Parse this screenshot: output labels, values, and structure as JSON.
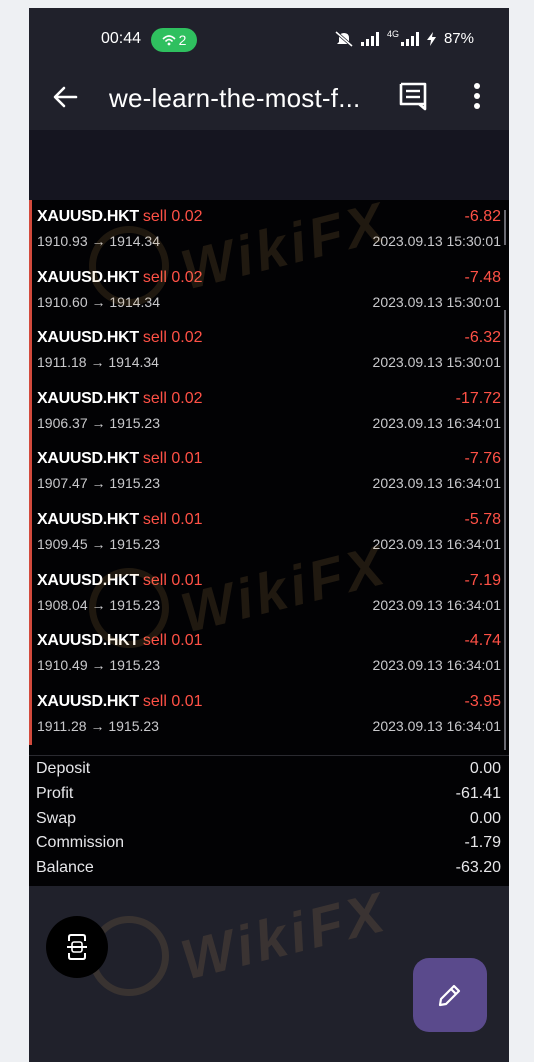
{
  "status": {
    "time": "00:44",
    "hotspot_count": "2",
    "battery": "87%",
    "network": "4G"
  },
  "appbar": {
    "title": "we-learn-the-most-f..."
  },
  "trades": [
    {
      "symbol": "XAUUSD.HKT",
      "side": "sell 0.02",
      "profit": "-6.82",
      "prices": "1910.93 → 1914.34",
      "time": "2023.09.13 15:30:01"
    },
    {
      "symbol": "XAUUSD.HKT",
      "side": "sell 0.02",
      "profit": "-7.48",
      "prices": "1910.60 → 1914.34",
      "time": "2023.09.13 15:30:01"
    },
    {
      "symbol": "XAUUSD.HKT",
      "side": "sell 0.02",
      "profit": "-6.32",
      "prices": "1911.18 → 1914.34",
      "time": "2023.09.13 15:30:01"
    },
    {
      "symbol": "XAUUSD.HKT",
      "side": "sell 0.02",
      "profit": "-17.72",
      "prices": "1906.37 → 1915.23",
      "time": "2023.09.13 16:34:01"
    },
    {
      "symbol": "XAUUSD.HKT",
      "side": "sell 0.01",
      "profit": "-7.76",
      "prices": "1907.47 → 1915.23",
      "time": "2023.09.13 16:34:01"
    },
    {
      "symbol": "XAUUSD.HKT",
      "side": "sell 0.01",
      "profit": "-5.78",
      "prices": "1909.45 → 1915.23",
      "time": "2023.09.13 16:34:01"
    },
    {
      "symbol": "XAUUSD.HKT",
      "side": "sell 0.01",
      "profit": "-7.19",
      "prices": "1908.04 → 1915.23",
      "time": "2023.09.13 16:34:01"
    },
    {
      "symbol": "XAUUSD.HKT",
      "side": "sell 0.01",
      "profit": "-4.74",
      "prices": "1910.49 → 1915.23",
      "time": "2023.09.13 16:34:01"
    },
    {
      "symbol": "XAUUSD.HKT",
      "side": "sell 0.01",
      "profit": "-3.95",
      "prices": "1911.28 → 1915.23",
      "time": "2023.09.13 16:34:01"
    }
  ],
  "summary": [
    {
      "label": "Deposit",
      "value": "0.00"
    },
    {
      "label": "Profit",
      "value": "-61.41"
    },
    {
      "label": "Swap",
      "value": "0.00"
    },
    {
      "label": "Commission",
      "value": "-1.79"
    },
    {
      "label": "Balance",
      "value": "-63.20"
    }
  ],
  "watermark": "WikiFX",
  "colors": {
    "loss_red": "#ff5146",
    "row_accent": "#d24a3c",
    "fab_purple": "#5a4a8c",
    "hotspot_green": "#2fc05f"
  },
  "icons": {
    "back": "arrow-left-icon",
    "comment": "comment-icon",
    "more": "more-vertical-icon",
    "edit": "pencil-icon",
    "scan": "scan-icon"
  }
}
